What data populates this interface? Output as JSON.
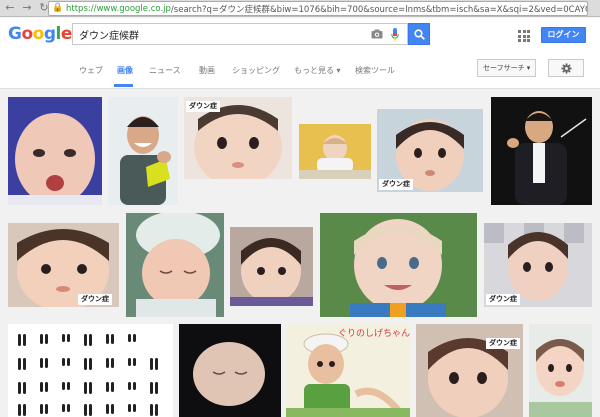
{
  "browser": {
    "url_secure": "https://www.google.co.jp",
    "url_rest": "/search?q=ダウン症候群&biw=1076&bih=700&source=lnms&tbm=isch&sa=X&sqi=2&ved=0CAYQ_"
  },
  "header": {
    "logo_letters": [
      {
        "ch": "G",
        "color": "#4285f4"
      },
      {
        "ch": "o",
        "color": "#ea4335"
      },
      {
        "ch": "o",
        "color": "#fbbc05"
      },
      {
        "ch": "g",
        "color": "#4285f4"
      },
      {
        "ch": "l",
        "color": "#34a853"
      },
      {
        "ch": "e",
        "color": "#ea4335"
      }
    ],
    "query": "ダウン症候群",
    "login_label": "ログイン"
  },
  "tabs": [
    {
      "label": "ウェブ",
      "active": false
    },
    {
      "label": "画像",
      "active": true
    },
    {
      "label": "ニュース",
      "active": false
    },
    {
      "label": "動画",
      "active": false
    },
    {
      "label": "ショッピング",
      "active": false
    },
    {
      "label": "もっと見る ▾",
      "active": false
    },
    {
      "label": "検索ツール",
      "active": false
    }
  ],
  "safe_search_label": "セーフサーチ ▾",
  "badge_label": "ダウン症",
  "bubble_text": "ぐりのしげちゃん",
  "accent_color": "#4285f4"
}
